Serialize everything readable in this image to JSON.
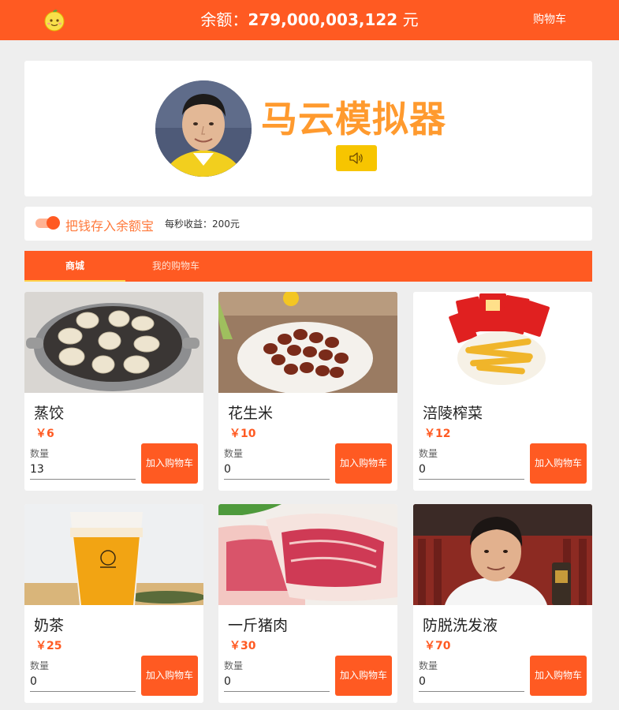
{
  "topbar": {
    "balance_prefix": "余额：",
    "balance_value": "279,000,003,122",
    "balance_unit": " 元",
    "cart_link": "购物车"
  },
  "hero": {
    "title": "马云模拟器"
  },
  "savebar": {
    "toggle_on": true,
    "label": "把钱存入余额宝",
    "earnings": "每秒收益：200元"
  },
  "tabs": [
    {
      "label": "商城",
      "active": true
    },
    {
      "label": "我的购物车",
      "active": false
    }
  ],
  "products": [
    {
      "name": "蒸饺",
      "price": "￥6",
      "qty_label": "数量",
      "qty": "13",
      "button": "加入购物车"
    },
    {
      "name": "花生米",
      "price": "￥10",
      "qty_label": "数量",
      "qty": "0",
      "button": "加入购物车"
    },
    {
      "name": "涪陵榨菜",
      "price": "￥12",
      "qty_label": "数量",
      "qty": "0",
      "button": "加入购物车"
    },
    {
      "name": "奶茶",
      "price": "￥25",
      "qty_label": "数量",
      "qty": "0",
      "button": "加入购物车"
    },
    {
      "name": "一斤猪肉",
      "price": "￥30",
      "qty_label": "数量",
      "qty": "0",
      "button": "加入购物车"
    },
    {
      "name": "防脱洗发液",
      "price": "￥70",
      "qty_label": "数量",
      "qty": "0",
      "button": "加入购物车"
    }
  ],
  "colors": {
    "accent": "#ff5a22",
    "title_orange": "#ff9a2e",
    "sound_button": "#f7c500",
    "page_bg": "#eeeeee"
  },
  "icons": {
    "logo": "lemon-face-icon",
    "sound": "speaker-icon"
  }
}
